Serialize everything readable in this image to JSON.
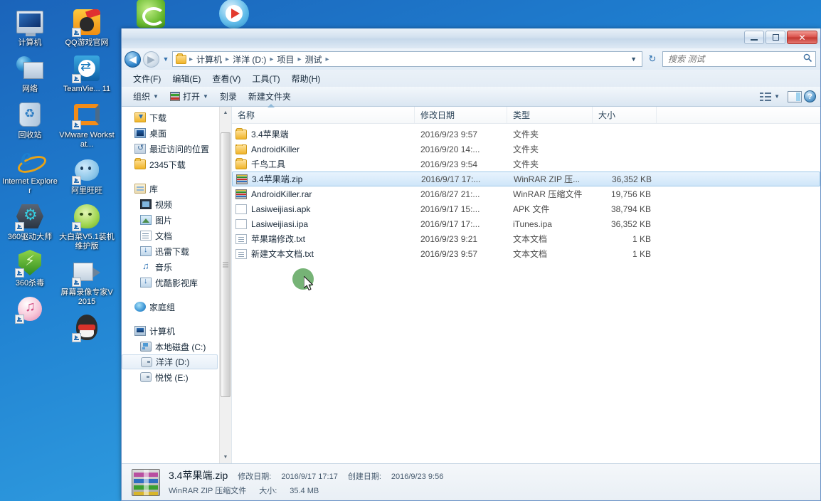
{
  "desktop": {
    "column1": [
      {
        "label": "计算机",
        "icon": "computer-icon",
        "shortcut": false
      },
      {
        "label": "网络",
        "icon": "network-icon",
        "shortcut": false
      },
      {
        "label": "回收站",
        "icon": "recycle-bin-icon",
        "shortcut": false
      },
      {
        "label": "Internet Explorer",
        "icon": "internet-explorer-icon",
        "shortcut": false
      },
      {
        "label": "360驱动大师",
        "icon": "360-driver-master-icon",
        "shortcut": true
      },
      {
        "label": "360杀毒",
        "icon": "360-antivirus-icon",
        "shortcut": true
      },
      {
        "label": "",
        "icon": "itunes-icon",
        "shortcut": true
      }
    ],
    "column2": [
      {
        "label": "QQ游戏官网",
        "icon": "qq-game-icon",
        "shortcut": true
      },
      {
        "label": "TeamVie... 11",
        "icon": "teamviewer-icon",
        "shortcut": true
      },
      {
        "label": "VMware Workstat...",
        "icon": "vmware-workstation-icon",
        "shortcut": true
      },
      {
        "label": "阿里旺旺",
        "icon": "aliwangwang-icon",
        "shortcut": true
      },
      {
        "label": "大白菜V5.1装机维护版",
        "icon": "dabaicai-icon",
        "shortcut": true
      },
      {
        "label": "屏幕录像专家V2015",
        "icon": "screen-recorder-icon",
        "shortcut": true
      },
      {
        "label": "",
        "icon": "qq-icon",
        "shortcut": true
      }
    ],
    "top_partial_icons": [
      {
        "icon": "green-browser-icon"
      },
      {
        "icon": "media-player-icon"
      }
    ]
  },
  "window": {
    "controls": {
      "minimize": "—",
      "maximize": "□",
      "close": "✕"
    }
  },
  "address": {
    "back_glyph": "◀",
    "forward_glyph": "▶",
    "recent_caret": "▼",
    "folder_icon": "folder-icon",
    "crumbs": [
      "计算机",
      "洋洋 (D:)",
      "项目",
      "测试"
    ],
    "separator": "▸",
    "dropdown_caret": "▼",
    "refresh_glyph": "↻"
  },
  "search": {
    "placeholder": "搜索 测试",
    "value": "",
    "icon": "search-icon"
  },
  "menubar": {
    "items": [
      "文件(F)",
      "编辑(E)",
      "查看(V)",
      "工具(T)",
      "帮助(H)"
    ]
  },
  "toolbar": {
    "organize": "组织",
    "organize_caret": "▼",
    "open": "打开",
    "open_caret": "▼",
    "burn": "刻录",
    "new_folder": "新建文件夹",
    "view_caret": "▼",
    "view_icon": "view-options-icon",
    "preview_pane_icon": "preview-pane-icon",
    "help_icon": "help-icon",
    "help_glyph": "?"
  },
  "navpane": {
    "groups": [
      {
        "items": [
          {
            "label": "下载",
            "icon": "downloads-icon",
            "indent": 1
          },
          {
            "label": "桌面",
            "icon": "desktop-icon",
            "indent": 1
          },
          {
            "label": "最近访问的位置",
            "icon": "recent-places-icon",
            "indent": 1
          },
          {
            "label": "2345下载",
            "icon": "folder-icon",
            "indent": 1
          }
        ]
      },
      {
        "items": [
          {
            "label": "库",
            "icon": "library-icon",
            "indent": 0
          },
          {
            "label": "视频",
            "icon": "videos-icon",
            "indent": 1
          },
          {
            "label": "图片",
            "icon": "pictures-icon",
            "indent": 1
          },
          {
            "label": "文档",
            "icon": "documents-icon",
            "indent": 1
          },
          {
            "label": "迅雷下载",
            "icon": "thunder-download-icon",
            "indent": 1
          },
          {
            "label": "音乐",
            "icon": "music-icon",
            "indent": 1
          },
          {
            "label": "优酷影视库",
            "icon": "youku-library-icon",
            "indent": 1
          }
        ]
      },
      {
        "items": [
          {
            "label": "家庭组",
            "icon": "homegroup-icon",
            "indent": 0
          }
        ]
      },
      {
        "items": [
          {
            "label": "计算机",
            "icon": "computer-icon",
            "indent": 0
          },
          {
            "label": "本地磁盘 (C:)",
            "icon": "system-drive-icon",
            "indent": 1
          },
          {
            "label": "洋洋 (D:)",
            "icon": "drive-icon",
            "indent": 1,
            "selected": true
          },
          {
            "label": "悦悦 (E:)",
            "icon": "drive-icon",
            "indent": 1
          }
        ]
      }
    ],
    "scrollbar": {
      "up_arrow": "▲",
      "down_arrow": "▼"
    }
  },
  "filelist": {
    "columns": [
      "名称",
      "修改日期",
      "类型",
      "大小"
    ],
    "sort_column": "名称",
    "sort_direction": "asc",
    "rows": [
      {
        "name": "3.4苹果端",
        "date": "2016/9/23 9:57",
        "type": "文件夹",
        "size": "",
        "icon": "folder-icon",
        "selected": false
      },
      {
        "name": "AndroidKiller",
        "date": "2016/9/20 14:...",
        "type": "文件夹",
        "size": "",
        "icon": "folder-icon",
        "selected": false
      },
      {
        "name": "千鸟工具",
        "date": "2016/9/23 9:54",
        "type": "文件夹",
        "size": "",
        "icon": "folder-icon",
        "selected": false
      },
      {
        "name": "3.4苹果端.zip",
        "date": "2016/9/17 17:...",
        "type": "WinRAR ZIP 压...",
        "size": "36,352 KB",
        "icon": "archive-icon",
        "selected": true
      },
      {
        "name": "AndroidKiller.rar",
        "date": "2016/8/27 21:...",
        "type": "WinRAR 压缩文件",
        "size": "19,756 KB",
        "icon": "archive-icon",
        "selected": false
      },
      {
        "name": "Lasiweijiasi.apk",
        "date": "2016/9/17 15:...",
        "type": "APK 文件",
        "size": "38,794 KB",
        "icon": "generic-file-icon",
        "selected": false
      },
      {
        "name": "Lasiweijiasi.ipa",
        "date": "2016/9/17 17:...",
        "type": "iTunes.ipa",
        "size": "36,352 KB",
        "icon": "generic-file-icon",
        "selected": false
      },
      {
        "name": "苹果端修改.txt",
        "date": "2016/9/23 9:21",
        "type": "文本文档",
        "size": "1 KB",
        "icon": "text-file-icon",
        "selected": false
      },
      {
        "name": "新建文本文档.txt",
        "date": "2016/9/23 9:57",
        "type": "文本文档",
        "size": "1 KB",
        "icon": "text-file-icon",
        "selected": false
      }
    ]
  },
  "details": {
    "icon": "winrar-archive-icon",
    "filename": "3.4苹果端.zip",
    "modified_label": "修改日期:",
    "modified_value": "2016/9/17 17:17",
    "created_label": "创建日期:",
    "created_value": "2016/9/23 9:56",
    "filetype": "WinRAR ZIP 压缩文件",
    "size_label": "大小:",
    "size_value": "35.4 MB"
  },
  "colors": {
    "desktop_blue": "#1f7fd0",
    "selection_blue": "#cfe6f9",
    "selection_border": "#9dc8e8",
    "close_button_red": "#c13730",
    "cursor_highlight_green": "#63a863",
    "folder_yellow": "#f0b429"
  }
}
